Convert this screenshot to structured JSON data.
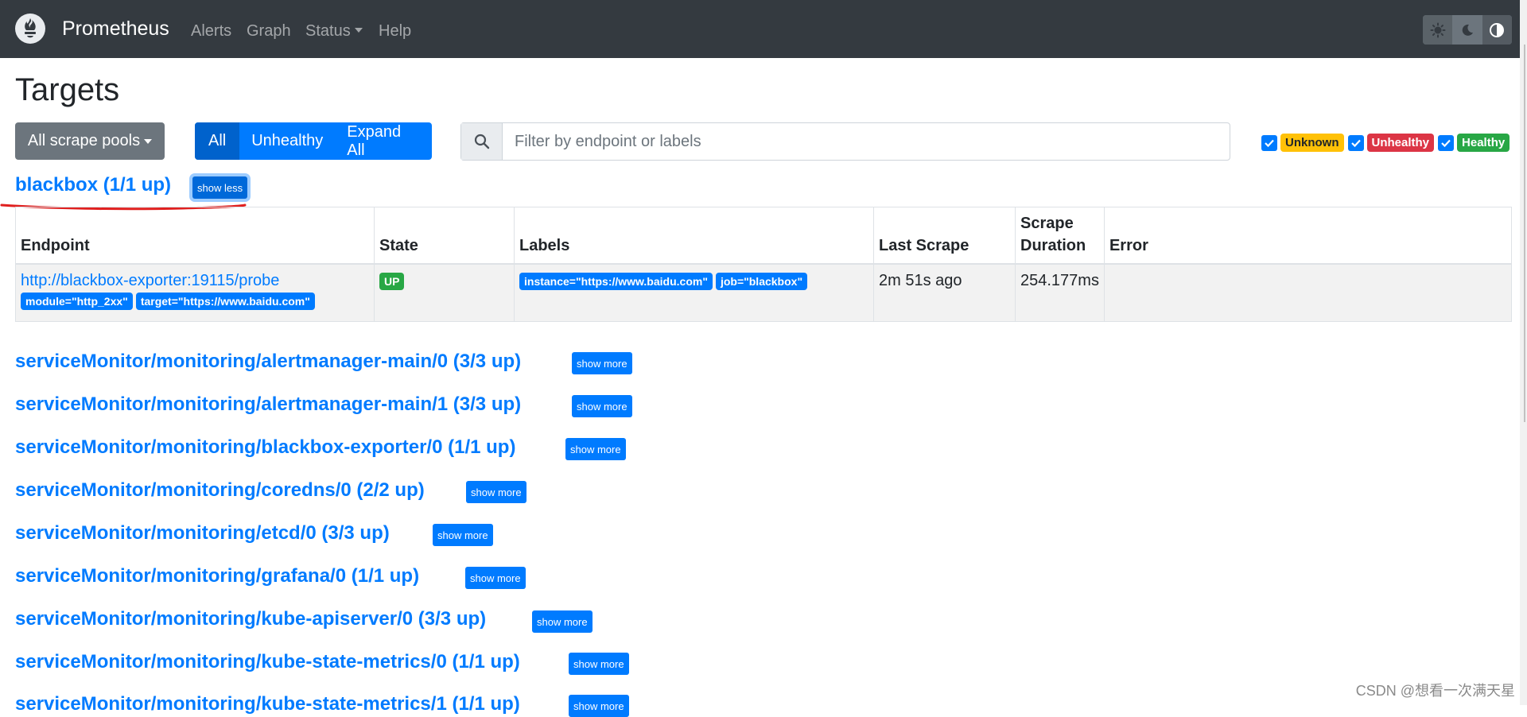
{
  "navbar": {
    "brand": "Prometheus",
    "links": [
      "Alerts",
      "Graph",
      "Status",
      "Help"
    ]
  },
  "page": {
    "title": "Targets"
  },
  "controls": {
    "scrape_pools_label": "All scrape pools",
    "filters": [
      "All",
      "Unhealthy",
      "Expand All"
    ],
    "search_placeholder": "Filter by endpoint or labels",
    "health": [
      "Unknown",
      "Unhealthy",
      "Healthy"
    ]
  },
  "expanded_pool": {
    "title": "blackbox (1/1 up)",
    "toggle": "show less",
    "columns": [
      "Endpoint",
      "State",
      "Labels",
      "Last Scrape",
      "Scrape Duration",
      "Error"
    ],
    "rows": [
      {
        "endpoint": "http://blackbox-exporter:19115/probe",
        "endpoint_labels": [
          "module=\"http_2xx\"",
          "target=\"https://www.baidu.com\""
        ],
        "state": "UP",
        "labels": [
          "instance=\"https://www.baidu.com\"",
          "job=\"blackbox\""
        ],
        "last_scrape": "2m 51s ago",
        "duration": "254.177ms",
        "error": ""
      }
    ]
  },
  "pools": [
    {
      "title": "serviceMonitor/monitoring/alertmanager-main/0 (3/3 up)",
      "toggle": "show more"
    },
    {
      "title": "serviceMonitor/monitoring/alertmanager-main/1 (3/3 up)",
      "toggle": "show more"
    },
    {
      "title": "serviceMonitor/monitoring/blackbox-exporter/0 (1/1 up)",
      "toggle": "show more"
    },
    {
      "title": "serviceMonitor/monitoring/coredns/0 (2/2 up)",
      "toggle": "show more"
    },
    {
      "title": "serviceMonitor/monitoring/etcd/0 (3/3 up)",
      "toggle": "show more"
    },
    {
      "title": "serviceMonitor/monitoring/grafana/0 (1/1 up)",
      "toggle": "show more"
    },
    {
      "title": "serviceMonitor/monitoring/kube-apiserver/0 (3/3 up)",
      "toggle": "show more"
    },
    {
      "title": "serviceMonitor/monitoring/kube-state-metrics/0 (1/1 up)",
      "toggle": "show more"
    },
    {
      "title": "serviceMonitor/monitoring/kube-state-metrics/1 (1/1 up)",
      "toggle": "show more"
    }
  ],
  "watermark": "CSDN @想看一次满天星",
  "colors": {
    "navbar": "#343a40",
    "primary": "#007bff",
    "secondary": "#6c757d",
    "success": "#28a745",
    "warning": "#ffc107",
    "danger": "#dc3545",
    "annotation": "#e0201f"
  },
  "icons": [
    "prometheus-logo-icon",
    "sun-icon",
    "moon-icon",
    "contrast-icon",
    "search-icon",
    "check-icon"
  ]
}
